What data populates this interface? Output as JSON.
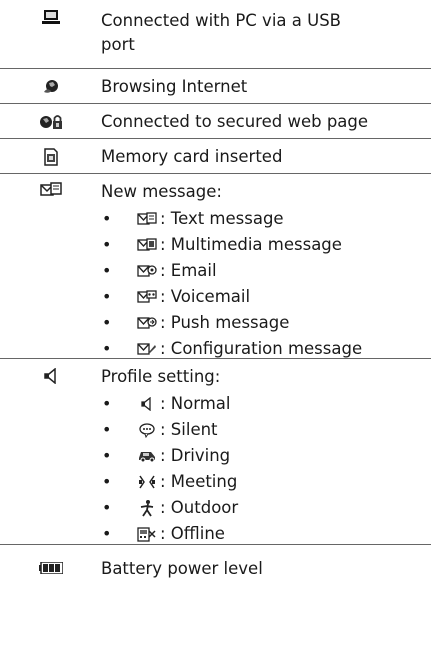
{
  "rows": [
    {
      "icon": "pc-monitor-icon",
      "text_line1": "Connected with PC via a USB",
      "text_line2": "port"
    },
    {
      "icon": "browser-globe-icon",
      "text": "Browsing Internet"
    },
    {
      "icon": "secure-web-lock-icon",
      "text": "Connected to secured web page"
    },
    {
      "icon": "memory-card-icon",
      "text": "Memory card inserted"
    },
    {
      "icon": "new-message-icon",
      "text": "New message:",
      "items": [
        {
          "icon": "text-message-icon",
          "label": ": Text message"
        },
        {
          "icon": "multimedia-message-icon",
          "label": ": Multimedia message"
        },
        {
          "icon": "email-icon",
          "label": ": Email"
        },
        {
          "icon": "voicemail-icon",
          "label": ": Voicemail"
        },
        {
          "icon": "push-message-icon",
          "label": ": Push message"
        },
        {
          "icon": "configuration-message-icon",
          "label": ": Configuration message"
        }
      ]
    },
    {
      "icon": "profile-speaker-icon",
      "text": "Profile setting:",
      "items": [
        {
          "icon": "normal-speaker-icon",
          "label": ": Normal"
        },
        {
          "icon": "silent-icon",
          "label": ": Silent"
        },
        {
          "icon": "driving-car-icon",
          "label": ": Driving"
        },
        {
          "icon": "meeting-icon",
          "label": ": Meeting"
        },
        {
          "icon": "outdoor-person-icon",
          "label": ": Outdoor"
        },
        {
          "icon": "offline-icon",
          "label": ": Offline"
        }
      ]
    },
    {
      "icon": "battery-icon",
      "text": "Battery power level"
    }
  ]
}
